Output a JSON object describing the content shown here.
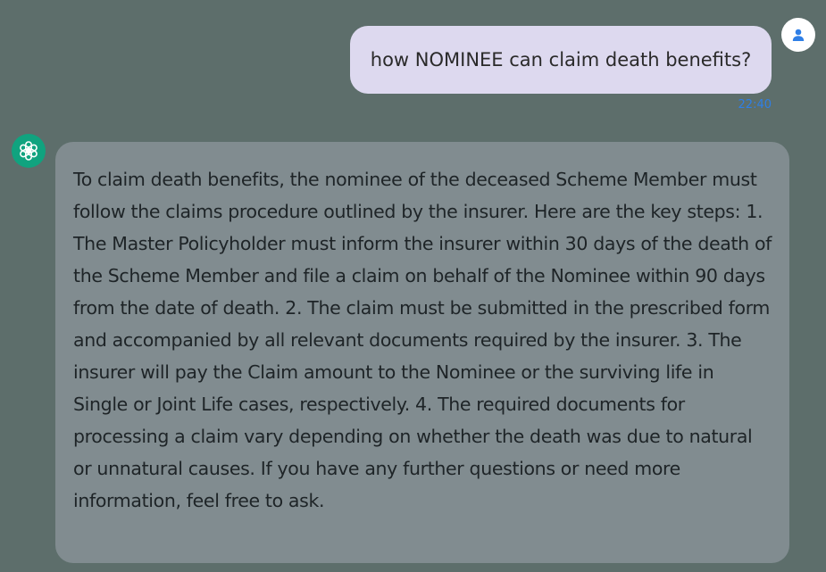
{
  "user_message": {
    "text": "how NOMINEE can claim death benefits?",
    "time": "22:40",
    "avatar_icon": "user-icon"
  },
  "bot_message": {
    "text": "To claim death benefits, the nominee of the deceased Scheme Member must follow the claims procedure outlined by the insurer. Here are the key steps: 1. The Master Policyholder must inform the insurer within 30 days of the death of the Scheme Member and file a claim on behalf of the Nominee within 90 days from the date of death. 2. The claim must be submitted in the prescribed form and accompanied by all relevant documents required by the insurer. 3. The insurer will pay the Claim amount to the Nominee or the surviving life in Single or Joint Life cases, respectively. 4. The required documents for processing a claim vary depending on whether the death was due to natural or unnatural causes. If you have any further questions or need more information, feel free to ask.",
    "time": "",
    "avatar_icon": "openai-logo-icon"
  },
  "colors": {
    "background": "#5d6e6b",
    "user_bubble": "#ddd9ef",
    "bot_bubble": "#818c90",
    "timestamp": "#2f7fe6",
    "bot_avatar": "#10a37f"
  }
}
